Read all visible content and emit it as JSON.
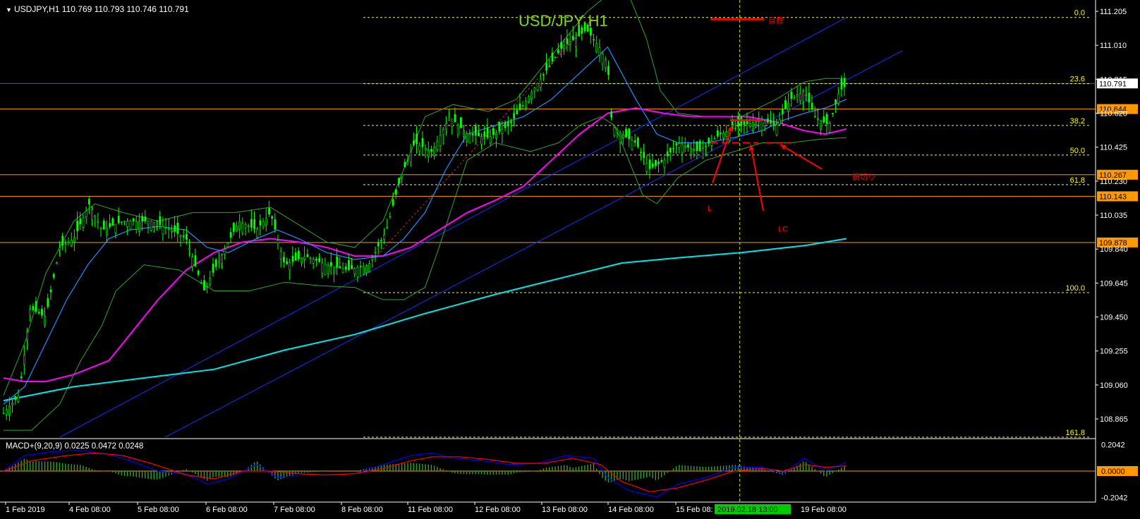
{
  "window": {
    "symbol_line": "USDJPY,H1  110.769 110.793 110.746 110.791",
    "chart_title": "USD/JPY  H1"
  },
  "colors": {
    "background": "#000000",
    "candle_up": "#00ff00",
    "candle_down": "#00ff00",
    "bollinger": "#2fa52f",
    "ma_short": "#1e90ff",
    "ma_mid": "#ff00ff",
    "ma_long": "#00e5e5",
    "fibo": "#ffff00",
    "horizontal_level": "#ff9900",
    "channel": "#1030ff",
    "annotation": "#ff0000",
    "macd_line": "#0000ff",
    "signal_line": "#ff0000",
    "grid_separator": "#808080"
  },
  "chart_data": [
    {
      "type": "candlestick",
      "title": "USD/JPY  H1",
      "ylim": [
        108.76,
        111.27
      ],
      "price_ticks": [
        "111.205",
        "111.010",
        "110.815",
        "110.620",
        "110.425",
        "110.230",
        "110.035",
        "109.840",
        "109.645",
        "109.450",
        "109.255",
        "109.060",
        "108.865"
      ],
      "current_price": "110.791",
      "horizontal_levels": [
        {
          "value": 110.644,
          "label": "110.644"
        },
        {
          "value": 110.267,
          "label": "110.267"
        },
        {
          "value": 110.143,
          "label": "110.143"
        },
        {
          "value": 109.878,
          "label": "109.878"
        }
      ],
      "fibonacci": [
        {
          "level": "0.0",
          "value": 111.17
        },
        {
          "level": "23.6",
          "value": 110.79
        },
        {
          "level": "38.2",
          "value": 110.55
        },
        {
          "level": "50.0",
          "value": 110.38
        },
        {
          "level": "61.8",
          "value": 110.21
        },
        {
          "level": "100.0",
          "value": 109.59
        },
        {
          "level": "161.8",
          "value": 108.76
        }
      ],
      "x_labels": [
        "1 Feb 2019",
        "4 Feb 08:00",
        "5 Feb 08:00",
        "6 Feb 08:00",
        "7 Feb 08:00",
        "8 Feb 08:00",
        "11 Feb 08:00",
        "12 Feb 08:00",
        "13 Feb 08:00",
        "14 Feb 08:00",
        "15 Feb 08:"
      ],
      "cursor_time": "2019.02.18 13:00",
      "x_label_last": "19 Feb 08:00",
      "price_path": [
        [
          0,
          108.9
        ],
        [
          22,
          109.0
        ],
        [
          38,
          109.5
        ],
        [
          60,
          109.45
        ],
        [
          80,
          109.85
        ],
        [
          100,
          109.9
        ],
        [
          122,
          110.1
        ],
        [
          140,
          109.95
        ],
        [
          170,
          110.0
        ],
        [
          210,
          110.0
        ],
        [
          240,
          109.95
        ],
        [
          260,
          109.9
        ],
        [
          285,
          109.6
        ],
        [
          310,
          109.8
        ],
        [
          335,
          110.0
        ],
        [
          360,
          109.95
        ],
        [
          380,
          110.05
        ],
        [
          400,
          109.75
        ],
        [
          430,
          109.8
        ],
        [
          460,
          109.75
        ],
        [
          490,
          109.72
        ],
        [
          520,
          109.75
        ],
        [
          545,
          109.95
        ],
        [
          565,
          110.25
        ],
        [
          585,
          110.45
        ],
        [
          610,
          110.4
        ],
        [
          635,
          110.6
        ],
        [
          660,
          110.5
        ],
        [
          690,
          110.48
        ],
        [
          720,
          110.55
        ],
        [
          745,
          110.7
        ],
        [
          770,
          110.85
        ],
        [
          795,
          111.0
        ],
        [
          815,
          111.05
        ],
        [
          830,
          111.1
        ],
        [
          848,
          111.0
        ],
        [
          860,
          110.9
        ],
        [
          866,
          110.55
        ],
        [
          880,
          110.5
        ],
        [
          900,
          110.45
        ],
        [
          920,
          110.3
        ],
        [
          940,
          110.35
        ],
        [
          960,
          110.45
        ],
        [
          990,
          110.4
        ],
        [
          1020,
          110.5
        ],
        [
          1050,
          110.55
        ],
        [
          1080,
          110.58
        ],
        [
          1100,
          110.55
        ],
        [
          1120,
          110.7
        ],
        [
          1140,
          110.75
        ],
        [
          1155,
          110.6
        ],
        [
          1175,
          110.55
        ],
        [
          1190,
          110.75
        ],
        [
          1200,
          110.78
        ]
      ],
      "ma_short": [
        [
          0,
          108.95
        ],
        [
          30,
          109.05
        ],
        [
          60,
          109.3
        ],
        [
          90,
          109.55
        ],
        [
          120,
          109.75
        ],
        [
          150,
          109.9
        ],
        [
          180,
          109.95
        ],
        [
          220,
          109.97
        ],
        [
          260,
          109.95
        ],
        [
          290,
          109.85
        ],
        [
          320,
          109.82
        ],
        [
          360,
          109.9
        ],
        [
          390,
          109.95
        ],
        [
          420,
          109.9
        ],
        [
          460,
          109.82
        ],
        [
          500,
          109.78
        ],
        [
          540,
          109.8
        ],
        [
          570,
          109.9
        ],
        [
          600,
          110.05
        ],
        [
          630,
          110.3
        ],
        [
          660,
          110.5
        ],
        [
          700,
          110.55
        ],
        [
          740,
          110.6
        ],
        [
          780,
          110.7
        ],
        [
          820,
          110.85
        ],
        [
          860,
          111.0
        ],
        [
          880,
          110.85
        ],
        [
          900,
          110.7
        ],
        [
          930,
          110.5
        ],
        [
          960,
          110.45
        ],
        [
          1000,
          110.45
        ],
        [
          1040,
          110.48
        ],
        [
          1080,
          110.52
        ],
        [
          1110,
          110.58
        ],
        [
          1140,
          110.62
        ],
        [
          1170,
          110.65
        ],
        [
          1200,
          110.7
        ]
      ],
      "ma_mid": [
        [
          0,
          109.1
        ],
        [
          30,
          109.08
        ],
        [
          60,
          109.08
        ],
        [
          100,
          109.12
        ],
        [
          150,
          109.2
        ],
        [
          180,
          109.35
        ],
        [
          220,
          109.55
        ],
        [
          260,
          109.72
        ],
        [
          300,
          109.82
        ],
        [
          340,
          109.88
        ],
        [
          380,
          109.9
        ],
        [
          420,
          109.88
        ],
        [
          460,
          109.85
        ],
        [
          500,
          109.8
        ],
        [
          540,
          109.8
        ],
        [
          580,
          109.85
        ],
        [
          620,
          109.95
        ],
        [
          660,
          110.05
        ],
        [
          700,
          110.12
        ],
        [
          740,
          110.2
        ],
        [
          780,
          110.35
        ],
        [
          820,
          110.5
        ],
        [
          860,
          110.62
        ],
        [
          900,
          110.65
        ],
        [
          940,
          110.62
        ],
        [
          980,
          110.6
        ],
        [
          1020,
          110.6
        ],
        [
          1060,
          110.6
        ],
        [
          1100,
          110.57
        ],
        [
          1140,
          110.52
        ],
        [
          1170,
          110.5
        ],
        [
          1200,
          110.53
        ]
      ],
      "ma_long": [
        [
          0,
          108.97
        ],
        [
          100,
          109.05
        ],
        [
          200,
          109.1
        ],
        [
          300,
          109.15
        ],
        [
          400,
          109.26
        ],
        [
          500,
          109.35
        ],
        [
          600,
          109.47
        ],
        [
          700,
          109.58
        ],
        [
          800,
          109.68
        ],
        [
          880,
          109.76
        ],
        [
          960,
          109.79
        ],
        [
          1050,
          109.82
        ],
        [
          1140,
          109.86
        ],
        [
          1200,
          109.9
        ]
      ],
      "bollinger_upper": [
        [
          0,
          109.0
        ],
        [
          30,
          109.3
        ],
        [
          60,
          109.7
        ],
        [
          100,
          110.0
        ],
        [
          130,
          110.1
        ],
        [
          170,
          110.05
        ],
        [
          220,
          110.0
        ],
        [
          270,
          110.05
        ],
        [
          330,
          110.05
        ],
        [
          380,
          110.08
        ],
        [
          420,
          109.98
        ],
        [
          460,
          109.88
        ],
        [
          500,
          109.85
        ],
        [
          540,
          110.0
        ],
        [
          570,
          110.3
        ],
        [
          600,
          110.6
        ],
        [
          640,
          110.67
        ],
        [
          690,
          110.63
        ],
        [
          730,
          110.7
        ],
        [
          770,
          110.9
        ],
        [
          800,
          111.05
        ],
        [
          830,
          111.2
        ],
        [
          860,
          111.3
        ],
        [
          890,
          111.3
        ],
        [
          915,
          111.05
        ],
        [
          935,
          110.75
        ],
        [
          960,
          110.62
        ],
        [
          1000,
          110.6
        ],
        [
          1050,
          110.6
        ],
        [
          1100,
          110.7
        ],
        [
          1140,
          110.8
        ],
        [
          1170,
          110.82
        ],
        [
          1200,
          110.82
        ]
      ],
      "bollinger_lower": [
        [
          0,
          108.8
        ],
        [
          40,
          108.8
        ],
        [
          80,
          108.95
        ],
        [
          110,
          109.2
        ],
        [
          140,
          109.4
        ],
        [
          160,
          109.6
        ],
        [
          200,
          109.75
        ],
        [
          250,
          109.72
        ],
        [
          300,
          109.6
        ],
        [
          350,
          109.6
        ],
        [
          400,
          109.65
        ],
        [
          450,
          109.63
        ],
        [
          500,
          109.62
        ],
        [
          540,
          109.55
        ],
        [
          570,
          109.55
        ],
        [
          600,
          109.62
        ],
        [
          620,
          109.85
        ],
        [
          640,
          110.1
        ],
        [
          660,
          110.35
        ],
        [
          700,
          110.45
        ],
        [
          750,
          110.4
        ],
        [
          790,
          110.45
        ],
        [
          820,
          110.55
        ],
        [
          850,
          110.6
        ],
        [
          870,
          110.55
        ],
        [
          890,
          110.35
        ],
        [
          910,
          110.15
        ],
        [
          930,
          110.1
        ],
        [
          960,
          110.25
        ],
        [
          1000,
          110.35
        ],
        [
          1040,
          110.4
        ],
        [
          1080,
          110.45
        ],
        [
          1120,
          110.45
        ],
        [
          1160,
          110.47
        ],
        [
          1200,
          110.48
        ]
      ],
      "annotations": [
        {
          "text": "目標",
          "price": 111.16
        },
        {
          "text": "損切り",
          "price": 110.24
        },
        {
          "text": "L",
          "price": 110.06
        },
        {
          "text": "LC",
          "price": 109.94
        }
      ]
    },
    {
      "type": "macd",
      "label": "MACD+(9,20,9) 0.0225 0.0472 0.0248",
      "ylim": [
        -0.24,
        0.24
      ],
      "ticks": [
        "0.2042",
        "0.0000",
        "-0.2042"
      ],
      "current_value": "0.0000",
      "macd": [
        [
          0,
          0.0
        ],
        [
          30,
          0.12
        ],
        [
          70,
          0.15
        ],
        [
          110,
          0.16
        ],
        [
          150,
          0.13
        ],
        [
          180,
          0.08
        ],
        [
          220,
          0.0
        ],
        [
          260,
          -0.02
        ],
        [
          290,
          -0.1
        ],
        [
          320,
          -0.06
        ],
        [
          360,
          0.05
        ],
        [
          390,
          -0.05
        ],
        [
          420,
          -0.03
        ],
        [
          460,
          -0.03
        ],
        [
          500,
          -0.02
        ],
        [
          540,
          0.05
        ],
        [
          580,
          0.12
        ],
        [
          610,
          0.14
        ],
        [
          640,
          0.1
        ],
        [
          680,
          0.08
        ],
        [
          720,
          0.05
        ],
        [
          760,
          0.06
        ],
        [
          800,
          0.12
        ],
        [
          840,
          0.1
        ],
        [
          860,
          -0.05
        ],
        [
          890,
          -0.15
        ],
        [
          930,
          -0.2
        ],
        [
          960,
          -0.1
        ],
        [
          1000,
          -0.05
        ],
        [
          1040,
          0.03
        ],
        [
          1080,
          0.03
        ],
        [
          1110,
          -0.02
        ],
        [
          1140,
          0.1
        ],
        [
          1170,
          0.0
        ],
        [
          1200,
          0.07
        ]
      ],
      "signal": [
        [
          0,
          0.0
        ],
        [
          40,
          0.08
        ],
        [
          90,
          0.12
        ],
        [
          130,
          0.14
        ],
        [
          170,
          0.12
        ],
        [
          210,
          0.06
        ],
        [
          260,
          -0.03
        ],
        [
          300,
          -0.06
        ],
        [
          340,
          0.0
        ],
        [
          380,
          0.0
        ],
        [
          420,
          -0.02
        ],
        [
          460,
          -0.03
        ],
        [
          500,
          -0.02
        ],
        [
          540,
          0.02
        ],
        [
          580,
          0.08
        ],
        [
          610,
          0.11
        ],
        [
          650,
          0.11
        ],
        [
          690,
          0.09
        ],
        [
          730,
          0.06
        ],
        [
          770,
          0.06
        ],
        [
          810,
          0.1
        ],
        [
          850,
          0.05
        ],
        [
          880,
          -0.08
        ],
        [
          920,
          -0.16
        ],
        [
          960,
          -0.13
        ],
        [
          1000,
          -0.07
        ],
        [
          1040,
          0.0
        ],
        [
          1080,
          0.02
        ],
        [
          1110,
          0.0
        ],
        [
          1140,
          0.05
        ],
        [
          1170,
          0.03
        ],
        [
          1200,
          0.04
        ]
      ]
    }
  ]
}
